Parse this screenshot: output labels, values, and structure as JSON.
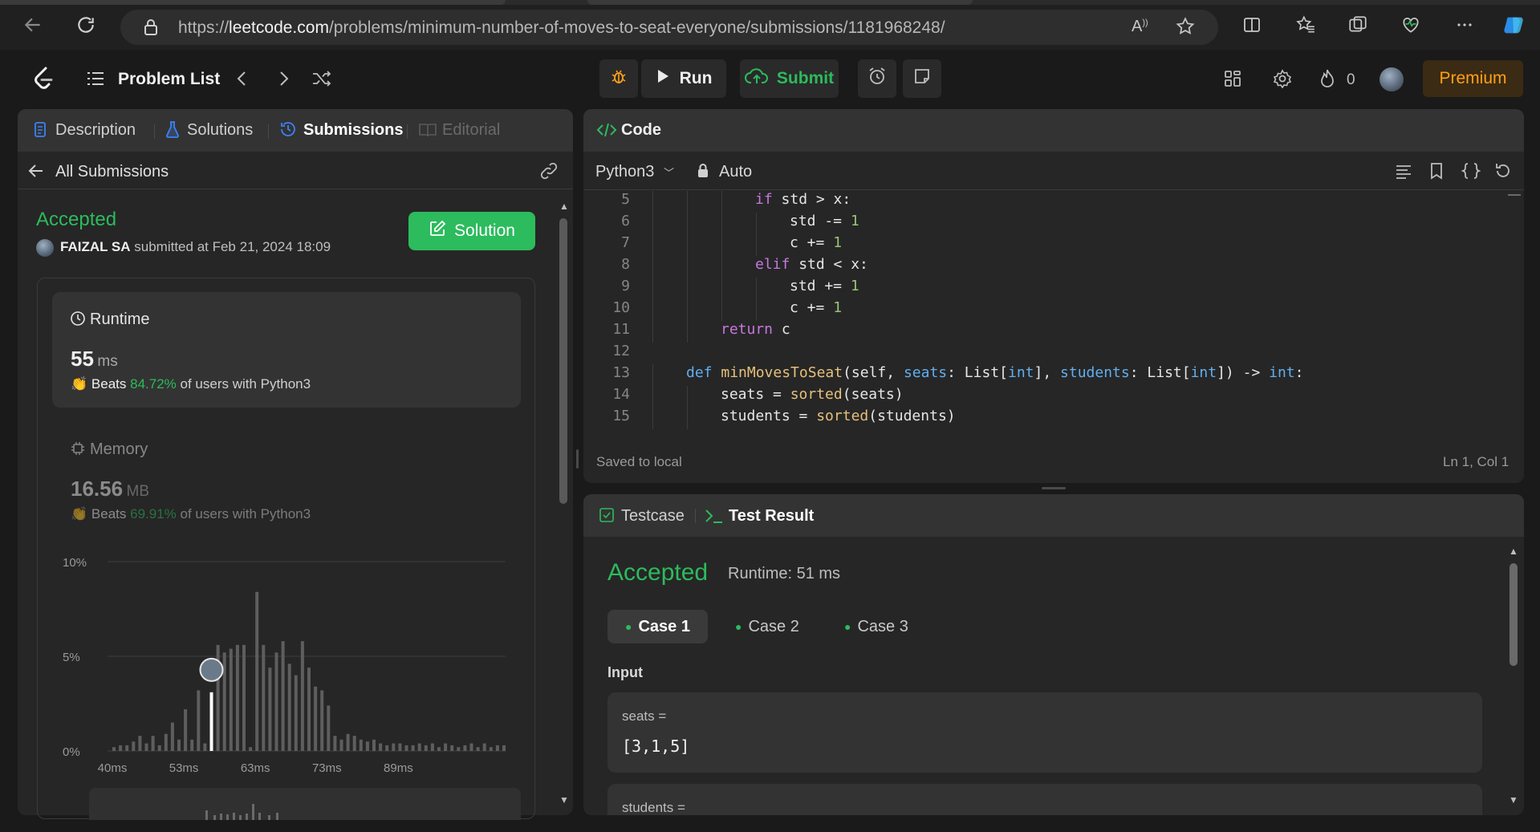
{
  "browser": {
    "url_prefix": "https://",
    "url_host": "leetcode.com",
    "url_path": "/problems/minimum-number-of-moves-to-seat-everyone/submissions/1181968248/"
  },
  "header": {
    "problem_list": "Problem List",
    "run": "Run",
    "submit": "Submit",
    "streak_count": "0",
    "premium": "Premium"
  },
  "left_panel": {
    "tabs": [
      "Description",
      "Solutions",
      "Submissions",
      "Editorial"
    ],
    "all_submissions": "All Submissions",
    "status": "Accepted",
    "submitter_name": "FAIZAL SA",
    "submitted_text": "submitted at Feb 21, 2024 18:09",
    "solution_button": "Solution",
    "runtime": {
      "label": "Runtime",
      "value": "55",
      "unit": "ms",
      "beats_prefix": "Beats",
      "beats_pct": "84.72%",
      "beats_suffix": "of users with Python3"
    },
    "memory": {
      "label": "Memory",
      "value": "16.56",
      "unit": "MB",
      "beats_prefix": "Beats",
      "beats_pct": "69.91%",
      "beats_suffix": "of users with Python3"
    }
  },
  "chart_data": {
    "type": "bar",
    "title": "",
    "xlabel": "",
    "ylabel": "",
    "x_tick_labels": [
      "40ms",
      "53ms",
      "63ms",
      "73ms",
      "89ms"
    ],
    "y_tick_labels": [
      "10%",
      "5%",
      "0%"
    ],
    "ylim": [
      0,
      10
    ],
    "highlight_index": 15,
    "values": [
      0.2,
      0.3,
      0.3,
      0.5,
      0.8,
      0.4,
      0.8,
      0.3,
      0.9,
      1.5,
      0.6,
      2.2,
      0.6,
      3.2,
      0.4,
      3.1,
      5.6,
      5.2,
      5.4,
      5.6,
      5.6,
      0.2,
      8.4,
      5.6,
      4.4,
      5.2,
      5.8,
      4.6,
      4.0,
      5.8,
      4.4,
      3.4,
      3.2,
      2.4,
      0.8,
      0.6,
      0.9,
      0.8,
      0.6,
      0.5,
      0.6,
      0.4,
      0.3,
      0.4,
      0.4,
      0.3,
      0.3,
      0.4,
      0.3,
      0.4,
      0.2,
      0.4,
      0.3,
      0.2,
      0.3,
      0.4,
      0.2,
      0.4,
      0.2,
      0.3,
      0.3
    ],
    "grid": true
  },
  "editor": {
    "title": "Code",
    "language": "Python3",
    "autosave": "Auto",
    "saved_status": "Saved to local",
    "cursor_pos": "Ln 1, Col 1",
    "lines": [
      {
        "n": "5",
        "indent": 3,
        "html": "<span class=\"kw\">if</span> std &gt; x:"
      },
      {
        "n": "6",
        "indent": 4,
        "html": "std -= <span class=\"num\">1</span>"
      },
      {
        "n": "7",
        "indent": 4,
        "html": "c += <span class=\"num\">1</span>"
      },
      {
        "n": "8",
        "indent": 3,
        "html": "<span class=\"kw\">elif</span> std &lt; x:"
      },
      {
        "n": "9",
        "indent": 4,
        "html": "std += <span class=\"num\">1</span>"
      },
      {
        "n": "10",
        "indent": 4,
        "html": "c += <span class=\"num\">1</span>"
      },
      {
        "n": "11",
        "indent": 2,
        "html": "<span class=\"kw\">return</span> c"
      },
      {
        "n": "12",
        "indent": 0,
        "html": ""
      },
      {
        "n": "13",
        "indent": 1,
        "html": "<span class=\"ty\">def</span> <span class=\"fn\">minMovesToSeat</span>(self, <span class=\"ty\">seats</span>: List[<span class=\"ty\">int</span>], <span class=\"ty\">students</span>: List[<span class=\"ty\">int</span>]) -&gt; <span class=\"ty\">int</span>:"
      },
      {
        "n": "14",
        "indent": 2,
        "html": "seats = <span class=\"fn\">sorted</span>(seats)"
      },
      {
        "n": "15",
        "indent": 2,
        "html": "students = <span class=\"fn\">sorted</span>(students)"
      }
    ]
  },
  "test_panel": {
    "tab_testcase": "Testcase",
    "tab_result": "Test Result",
    "status": "Accepted",
    "runtime": "Runtime: 51 ms",
    "cases": [
      "Case 1",
      "Case 2",
      "Case 3"
    ],
    "input_label": "Input",
    "seats_label": "seats =",
    "seats_value": "[3,1,5]",
    "students_label": "students ="
  }
}
